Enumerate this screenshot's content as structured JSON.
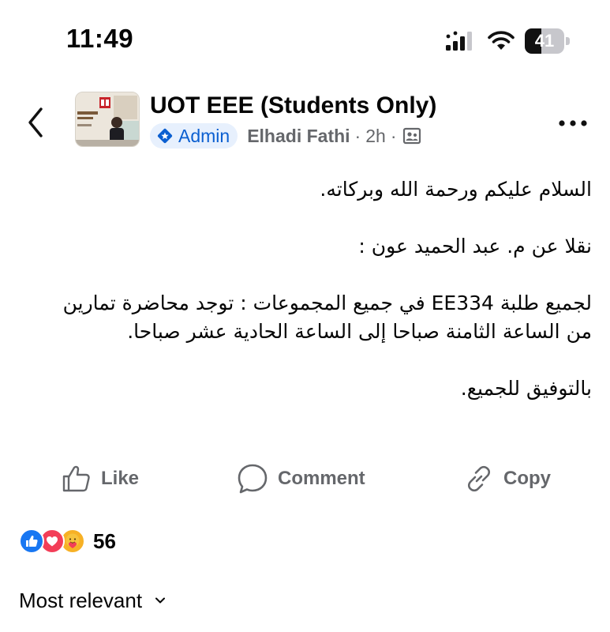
{
  "status_bar": {
    "time": "11:49",
    "battery_level": "41",
    "battery_fraction": 0.41,
    "icons": [
      "cellular-signal-icon",
      "wifi-icon",
      "battery-icon"
    ]
  },
  "post": {
    "group_name": "UOT EEE (Students Only)",
    "admin_label": "Admin",
    "author": "Elhadi Fathi",
    "separator": "·",
    "age": "2h",
    "body_paragraphs": [
      "السلام عليكم ورحمة الله وبركاته.",
      "نقلا عن م. عبد الحميد عون :",
      "لجميع طلبة EE334 في جميع المجموعات : توجد محاضرة تمارين من الساعة الثامنة صباحا إلى الساعة الحادية عشر صباحا.",
      "بالتوفيق للجميع."
    ]
  },
  "actions": {
    "like": "Like",
    "comment": "Comment",
    "copy": "Copy"
  },
  "reactions": {
    "types": [
      "like",
      "love",
      "care"
    ],
    "count": "56"
  },
  "comments": {
    "sort_label": "Most relevant"
  },
  "colors": {
    "accent_blue": "#1877f2",
    "admin_badge_bg": "#e7f0fd",
    "secondary_text": "#65676b",
    "love_red": "#f33e58",
    "care_yellow": "#f7b125"
  }
}
